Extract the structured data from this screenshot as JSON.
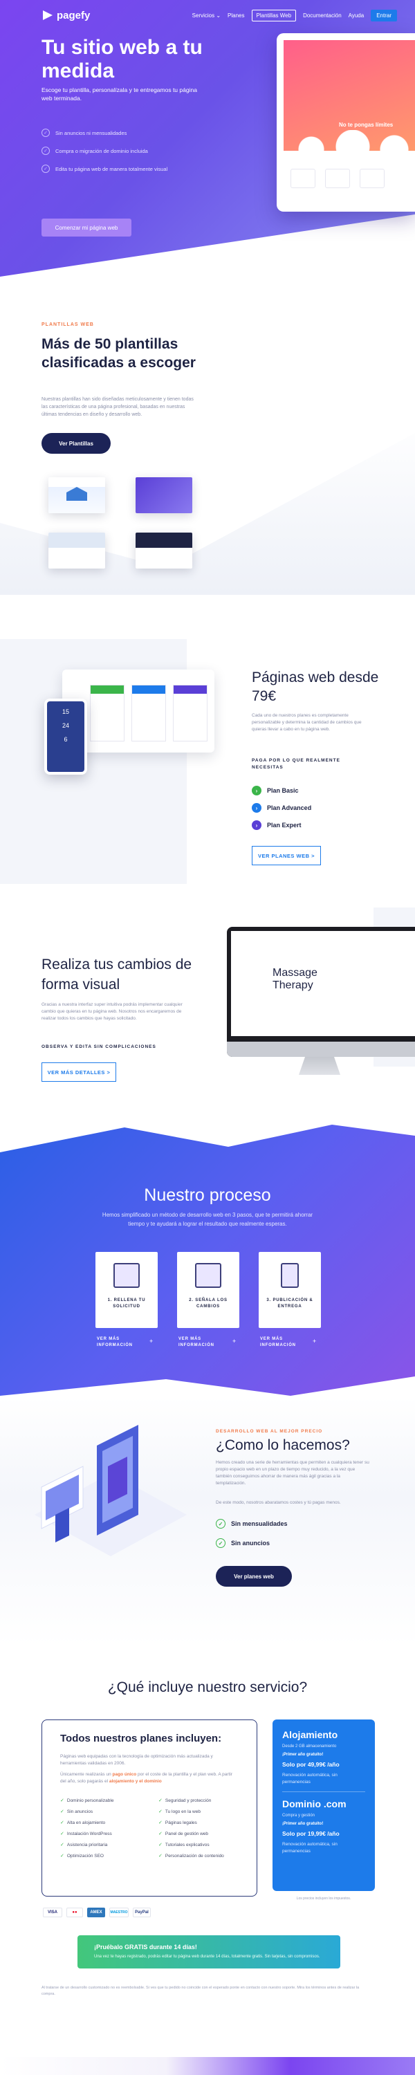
{
  "nav": {
    "brand": "pagefy",
    "links": [
      "Servicios ⌄",
      "Planes",
      "Plantillas Web",
      "Documentación",
      "Ayuda"
    ],
    "cta": "Entrar"
  },
  "hero": {
    "title": "Tu sitio web a tu medida",
    "subtitle": "Escoge tu plantilla, personalízala y te entregamos tu página web terminada.",
    "checks": [
      "Sin anuncios ni mensualidades",
      "Compra o migración de dominio incluida",
      "Edita tu página web de manera totalmente visual"
    ],
    "button": "Comenzar mi página web",
    "screen_title": "No te pongas límites"
  },
  "templates": {
    "tag": "PLANTILLAS WEB",
    "title": "Más de 50 plantillas clasificadas a escoger",
    "text": "Nuestras plantillas han sido diseñadas meticulosamente y tienen todas las características de una página profesional, basadas en nuestras últimas tendencias en diseño y desarrollo web.",
    "button": "Ver Plantillas"
  },
  "pricing_intro": {
    "title": "Páginas web desde 79€",
    "text": "Cada uno de nuestros planes es completamente personalizable y determina la cantidad de cambios que quieras llevar a cabo en tu página web.",
    "label": "PAGA POR LO QUE REALMENTE NECESITAS",
    "plans": [
      {
        "name": "Plan Basic",
        "color": "#3bb54a"
      },
      {
        "name": "Plan Advanced",
        "color": "#1d7bea"
      },
      {
        "name": "Plan Expert",
        "color": "#5a3fd6"
      }
    ],
    "button": "VER PLANES WEB >",
    "phone_values": [
      "15",
      "24",
      "6"
    ]
  },
  "visual": {
    "title": "Realiza tus cambios de forma visual",
    "text": "Gracias a nuestra interfaz super intuitiva podrás implementar cualquier cambio que quieras en tu página web. Nosotros nos encargaremos de realizar todos los cambios que hayas solicitado.",
    "label": "OBSERVA Y EDITA SIN COMPLICACIONES",
    "button": "VER MÁS DETALLES >",
    "screen_text": "Massage Therapy"
  },
  "process": {
    "title": "Nuestro proceso",
    "text": "Hemos simplificado un método de desarrollo web en 3 pasos, que te permitirá ahorrar tiempo y te ayudará a lograr el resultado que realmente esperas.",
    "steps": [
      {
        "label": "1. RELLENA TU SOLICITUD",
        "more": "VER MÁS INFORMACIÓN"
      },
      {
        "label": "2. SEÑALA LOS CAMBIOS",
        "more": "VER MÁS INFORMACIÓN"
      },
      {
        "label": "3. PUBLICACIÓN & ENTREGA",
        "more": "VER MÁS INFORMACIÓN"
      }
    ],
    "plus": "+"
  },
  "how": {
    "tag": "DESARROLLO WEB AL MEJOR PRECIO",
    "title": "¿Como lo hacemos?",
    "text1": "Hemos creado una serie de herramientas que permiten a cualquiera tener su propio espacio web en un plazo de tiempo muy reducido, a la vez que también conseguimos ahorrar de manera más ágil gracias a la templatización.",
    "text2": "De este modo, nosotros abaratamos costes y tú pagas menos.",
    "checks": [
      "Sin mensualidades",
      "Sin anuncios"
    ],
    "button": "Ver planes web"
  },
  "service": {
    "title": "¿Qué incluye nuestro servicio?",
    "box_title": "Todos nuestros planes incluyen:",
    "p1": "Páginas web equipadas con la tecnología de optimización más actualizada y herramientas validadas en 2006.",
    "p2_pre": "Únicamente realizarás un ",
    "p2_bold": "pago único",
    "p2_mid": " por el coste de la plantilla y el plan web. A partir del año, solo pagarás el ",
    "p2_bold2": "alojamiento y el dominio",
    "features_left": [
      "Dominio personalizable",
      "Sin anuncios",
      "Alta en alojamiento",
      "Instalación WordPress",
      "Asistencia prioritaria",
      "Optimización SEO"
    ],
    "features_right": [
      "Seguridad y protección",
      "Tu logo en la web",
      "Páginas legales",
      "Panel de gestión web",
      "Tutoriales explicativos",
      "Personalización de contenido"
    ],
    "hosting": {
      "title": "Alojamiento",
      "sub1": "Desde 2 GB almacenamiento",
      "sub2": "¡Primer año gratuito!",
      "price": "Solo por 49,99€ /año",
      "note": "Renovación automática, sin permanencias"
    },
    "domain": {
      "title": "Dominio .com",
      "sub1": "Compra y gestión",
      "sub2": "¡Primer año gratuito!",
      "price": "Solo por 19,99€ /año",
      "note": "Renovación automática, sin permanencias"
    },
    "price_note": "Los precios incluyen los impuestos.",
    "payments": [
      "VISA",
      "●●",
      "AMEX",
      "MAESTRO",
      "PayPal"
    ]
  },
  "trial": {
    "title": "¡Pruébalo GRATIS durante 14 días!",
    "text": "Una vez te hayas registrado, podrás editar tu página web durante 14 días, totalmente gratis. Sin tarjetas, sin compromisos."
  },
  "footnote": "Al tratarse de un desarrollo customizado no es reembolsable. Si ves que tu pedido no coincide con el esperado ponte en contacto con nuestro soporte. Mira los términos antes de realizar la compra."
}
